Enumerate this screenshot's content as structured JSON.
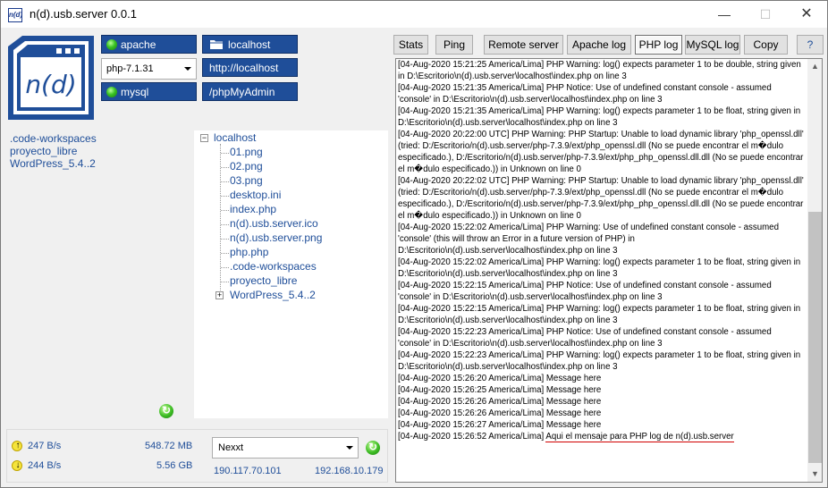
{
  "window": {
    "title": "n(d).usb.server 0.0.1",
    "icon_text": "n(d)",
    "minimize": "—",
    "maximize": "☐",
    "close": "✕"
  },
  "logo": {
    "text": "n(d)"
  },
  "controls": {
    "apache": "apache",
    "mysql": "mysql",
    "php_version": "php-7.1.31",
    "localhost": "localhost",
    "url": "http://localhost",
    "phpmyadmin": "/phpMyAdmin"
  },
  "projects": [
    ".code-workspaces",
    "proyecto_libre",
    "WordPress_5.4..2"
  ],
  "tree": {
    "root": "localhost",
    "children": [
      "01.png",
      "02.png",
      "03.png",
      "desktop.ini",
      "index.php",
      "n(d).usb.server.ico",
      "n(d).usb.server.png",
      "php.php",
      ".code-workspaces",
      "proyecto_libre",
      "WordPress_5.4..2"
    ]
  },
  "stats": {
    "upload_rate": "247 B/s",
    "upload_total": "548.72 MB",
    "download_rate": "244 B/s",
    "download_total": "5.56 GB",
    "network": "Nexxt",
    "public_ip": "190.117.70.101",
    "local_ip": "192.168.10.179"
  },
  "tabs": [
    "Stats",
    "Ping",
    "Remote server",
    "Apache log",
    "PHP log",
    "MySQL log",
    "Copy"
  ],
  "active_tab": "PHP log",
  "help": "?",
  "log": [
    "[04-Aug-2020 15:21:25 America/Lima] PHP Warning:  log() expects parameter 1 to be double, string given in D:\\Escritorio\\n(d).usb.server\\localhost\\index.php on line 3",
    "[04-Aug-2020 15:21:35 America/Lima] PHP Notice:  Use of undefined constant console - assumed 'console' in D:\\Escritorio\\n(d).usb.server\\localhost\\index.php on line 3",
    "[04-Aug-2020 15:21:35 America/Lima] PHP Warning:  log() expects parameter 1 to be float, string given in D:\\Escritorio\\n(d).usb.server\\localhost\\index.php on line 3",
    "[04-Aug-2020 20:22:00 UTC] PHP Warning:  PHP Startup: Unable to load dynamic library 'php_openssl.dll' (tried: D:/Escritorio/n(d).usb.server/php-7.3.9/ext/php_openssl.dll (No se puede encontrar el m�dulo especificado.), D:/Escritorio/n(d).usb.server/php-7.3.9/ext/php_php_openssl.dll.dll (No se puede encontrar el m�dulo especificado.)) in Unknown on line 0",
    "[04-Aug-2020 20:22:02 UTC] PHP Warning:  PHP Startup: Unable to load dynamic library 'php_openssl.dll' (tried: D:/Escritorio/n(d).usb.server/php-7.3.9/ext/php_openssl.dll (No se puede encontrar el m�dulo especificado.), D:/Escritorio/n(d).usb.server/php-7.3.9/ext/php_php_openssl.dll.dll (No se puede encontrar el m�dulo especificado.)) in Unknown on line 0",
    "[04-Aug-2020 15:22:02 America/Lima] PHP Warning:  Use of undefined constant console - assumed 'console' (this will throw an Error in a future version of PHP) in D:\\Escritorio\\n(d).usb.server\\localhost\\index.php on line 3",
    "[04-Aug-2020 15:22:02 America/Lima] PHP Warning:  log() expects parameter 1 to be float, string given in D:\\Escritorio\\n(d).usb.server\\localhost\\index.php on line 3",
    "[04-Aug-2020 15:22:15 America/Lima] PHP Notice:  Use of undefined constant console - assumed 'console' in D:\\Escritorio\\n(d).usb.server\\localhost\\index.php on line 3",
    "[04-Aug-2020 15:22:15 America/Lima] PHP Warning:  log() expects parameter 1 to be float, string given in D:\\Escritorio\\n(d).usb.server\\localhost\\index.php on line 3",
    "[04-Aug-2020 15:22:23 America/Lima] PHP Notice:  Use of undefined constant console - assumed 'console' in D:\\Escritorio\\n(d).usb.server\\localhost\\index.php on line 3",
    "[04-Aug-2020 15:22:23 America/Lima] PHP Warning:  log() expects parameter 1 to be float, string given in D:\\Escritorio\\n(d).usb.server\\localhost\\index.php on line 3",
    "[04-Aug-2020 15:26:20 America/Lima] Message here",
    "[04-Aug-2020 15:26:25 America/Lima] Message here",
    "[04-Aug-2020 15:26:26 America/Lima] Message here",
    "[04-Aug-2020 15:26:26 America/Lima] Message here",
    "[04-Aug-2020 15:26:27 America/Lima] Message here"
  ],
  "log_last_prefix": "[04-Aug-2020 15:26:52 America/Lima]",
  "log_last_message": "Aqui el mensaje para PHP log de n(d).usb.server",
  "colors": {
    "accent": "#1f4e99",
    "highlight_underline": "#d10000"
  }
}
